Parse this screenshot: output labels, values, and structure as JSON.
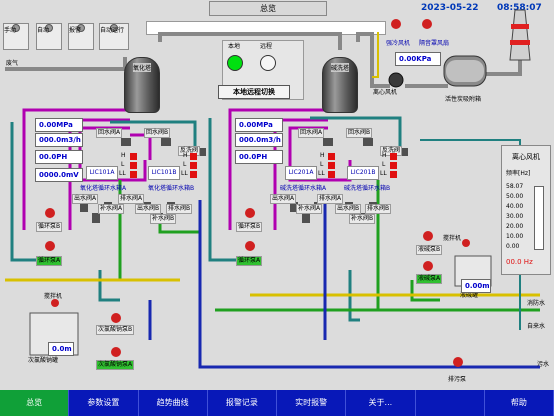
{
  "header": {
    "mode_buttons": [
      "手动",
      "自动",
      "报警",
      "自动运行"
    ],
    "title_tab": "总览",
    "date": "2023-05-22",
    "time": "08:58:07"
  },
  "top_controls": {
    "local_label": "本地",
    "remote_label": "远程",
    "switch_button": "本地远程切换"
  },
  "towers": {
    "left": "氧化塔",
    "right": "碱洗塔"
  },
  "fans": {
    "strong_fan": "强冷风机",
    "anti_fan": "隔音罩风扇",
    "pressure": "0.00KPa",
    "centrifugal_fan": "离心风机",
    "carbon_box": "活性炭吸附箱"
  },
  "readouts": {
    "pressure": "0.00MPa",
    "flow": "000.0m3/h",
    "ph": "00.0PH",
    "orp": "0000.0mV",
    "pressure2": "0.00MPa",
    "flow2": "000.0m3/h",
    "ph2": "00.0PH"
  },
  "valves": {
    "return_a": "回水阀A",
    "return_b": "回水阀B",
    "backwash": "反洗阀",
    "return_a2": "回水阀A",
    "return_b2": "回水阀B",
    "backwash2": "反洗阀",
    "outlet_a": "出水阀A",
    "fill_a": "补水阀A",
    "drain_a": "排水阀A",
    "outlet_b": "出水阀B",
    "fill_b": "补水阀B",
    "drain_b": "排水阀B",
    "outlet_a2": "出水阀A",
    "fill_a2": "补水阀A",
    "drain_a2": "排水阀A",
    "outlet_b2": "出水阀B",
    "fill_b2": "补水阀B",
    "drain_b2": "排水阀B"
  },
  "level_controls": {
    "lic101a": "LIC101A",
    "lic101b": "LIC101B",
    "lic201a": "LIC201A",
    "lic201b": "LIC201B",
    "tank_a": "氧化塔循环水箱A",
    "tank_b": "氧化塔循环水箱B",
    "tank_a2": "碱洗塔循环水箱A",
    "tank_b2": "碱洗塔循环水箱B",
    "h": "H",
    "l": "L",
    "ll": "LL"
  },
  "pumps": {
    "circ_b": "循环泵B",
    "circ_a": "循环泵A",
    "circ_b2": "循环泵B",
    "circ_a2": "循环泵A",
    "dosing_b": "次氯酸钠泵B",
    "dosing_a": "次氯酸钠泵A",
    "caustic_b": "液碱泵B",
    "caustic_a": "液碱泵A"
  },
  "mixers": {
    "mixer1": "搅拌机",
    "mixer2": "搅拌机",
    "naclo_tank": "次氯酸钠罐",
    "caustic_tank": "液碱罐",
    "level1": "0.0m",
    "level2": "0.00m"
  },
  "side_labels": {
    "exhaust": "废气",
    "fire_water": "消防水",
    "tap_water": "自来水",
    "sewage": "污水",
    "drain_pump": "排污泵"
  },
  "fan_panel": {
    "title": "离心风机",
    "freq_label": "频率[Hz]",
    "ticks": [
      "58.07",
      "50.00",
      "40.00",
      "30.00",
      "20.00",
      "10.00",
      "0.00"
    ],
    "freq_value": "00.0 Hz"
  },
  "nav": [
    "总览",
    "参数设置",
    "趋势曲线",
    "报警记录",
    "实时报警",
    "关于...",
    "",
    "帮助"
  ],
  "colors": {
    "nav_bg": "#0818b8",
    "nav_active": "#10a038",
    "value_text": "#0000cc",
    "alarm": "#e01010",
    "local_led": "#00e010"
  }
}
